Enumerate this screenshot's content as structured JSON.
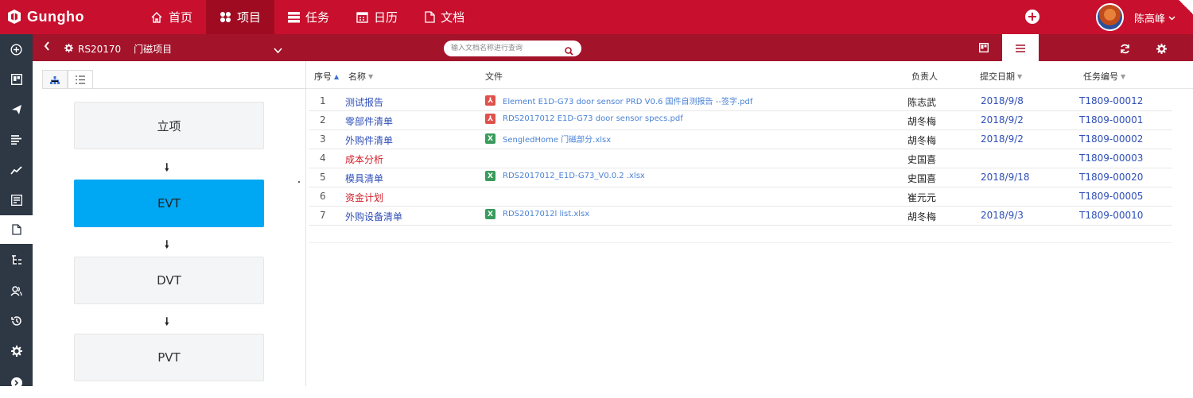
{
  "app": {
    "logo_text": "Gungho"
  },
  "nav": {
    "items": [
      {
        "label": "首页",
        "icon": "home-icon"
      },
      {
        "label": "项目",
        "icon": "grid-icon"
      },
      {
        "label": "任务",
        "icon": "task-icon"
      },
      {
        "label": "日历",
        "icon": "calendar-icon"
      },
      {
        "label": "文档",
        "icon": "document-icon"
      }
    ],
    "active": "项目"
  },
  "user": {
    "name": "陈高峰"
  },
  "project": {
    "code": "RS20170",
    "name": "门磁项目"
  },
  "search": {
    "placeholder": "输入文档名称进行查询"
  },
  "stages": [
    "立项",
    "EVT",
    "DVT",
    "PVT"
  ],
  "table": {
    "headers": {
      "seq": "序号",
      "name": "名称",
      "file": "文件",
      "owner": "负责人",
      "date": "提交日期",
      "task_id": "任务编号"
    },
    "rows": [
      {
        "seq": "1",
        "name": "测试报告",
        "file_type": "pdf",
        "file": "Element E1D-G73 door sensor PRD V0.6  国件自测报告 --签字.pdf",
        "owner": "陈志武",
        "date": "2018/9/8",
        "task_id": "T1809-00012"
      },
      {
        "seq": "2",
        "name": "零部件清单",
        "file_type": "pdf",
        "file": "RDS2017012 E1D-G73 door sensor specs.pdf",
        "owner": "胡冬梅",
        "date": "2018/9/2",
        "task_id": "T1809-00001"
      },
      {
        "seq": "3",
        "name": "外购件清单",
        "file_type": "xls",
        "file": "SengledHome 门磁部分.xlsx",
        "owner": "胡冬梅",
        "date": "2018/9/2",
        "task_id": "T1809-00002"
      },
      {
        "seq": "4",
        "name": "成本分析",
        "name_color": "red",
        "file_type": "",
        "file": "",
        "owner": "史国喜",
        "date": "",
        "task_id": "T1809-00003"
      },
      {
        "seq": "5",
        "name": "模具清单",
        "file_type": "xls",
        "file": "RDS2017012_E1D-G73_V0.0.2 .xlsx",
        "owner": "史国喜",
        "date": "2018/9/18",
        "task_id": "T1809-00020"
      },
      {
        "seq": "6",
        "name": "资金计划",
        "name_color": "red",
        "file_type": "",
        "file": "",
        "owner": "崔元元",
        "date": "",
        "task_id": "T1809-00005"
      },
      {
        "seq": "7",
        "name": "外购设备清单",
        "file_type": "xls",
        "file": "RDS2017012l  list.xlsx",
        "owner": "胡冬梅",
        "date": "2018/9/3",
        "task_id": "T1809-00010"
      }
    ]
  },
  "colors": {
    "topbar": "#c8102e",
    "subbar": "#a3132a",
    "sidebar": "#2e3744",
    "active_stage": "#00a8f3",
    "link": "#2f4fb8",
    "danger_link": "#d0202a"
  }
}
